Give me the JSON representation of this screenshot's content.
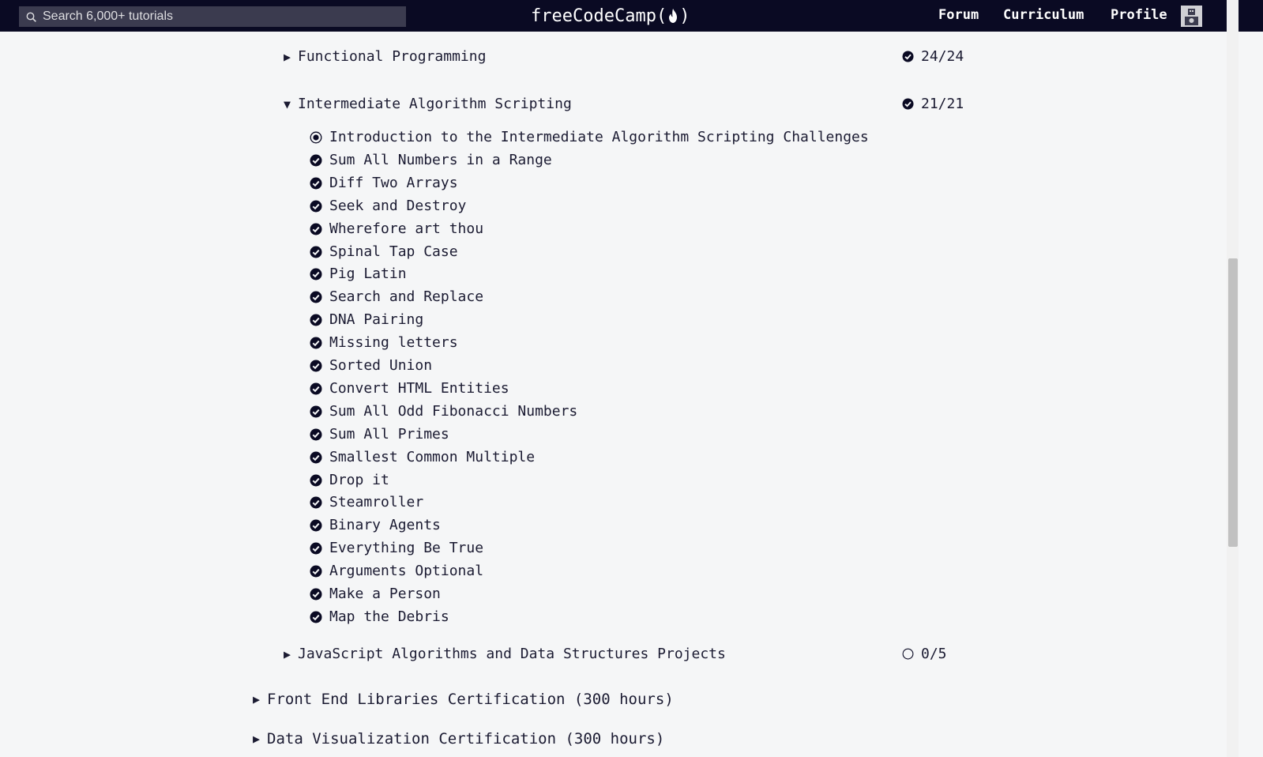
{
  "header": {
    "search_placeholder": "Search 6,000+ tutorials",
    "logo_text_left": "freeCodeCamp(",
    "logo_text_right": ")",
    "nav": [
      "Forum",
      "Curriculum",
      "Profile"
    ]
  },
  "blocks": [
    {
      "title": "Functional Programming",
      "expanded": false,
      "progress": "24/24",
      "complete": true
    },
    {
      "title": "Intermediate Algorithm Scripting",
      "expanded": true,
      "progress": "21/21",
      "complete": true
    },
    {
      "title": "JavaScript Algorithms and Data Structures Projects",
      "expanded": false,
      "progress": "0/5",
      "complete": false
    }
  ],
  "challenges": [
    {
      "title": "Introduction to the Intermediate Algorithm Scripting Challenges",
      "status": "intro"
    },
    {
      "title": "Sum All Numbers in a Range",
      "status": "done"
    },
    {
      "title": "Diff Two Arrays",
      "status": "done"
    },
    {
      "title": "Seek and Destroy",
      "status": "done"
    },
    {
      "title": "Wherefore art thou",
      "status": "done"
    },
    {
      "title": "Spinal Tap Case",
      "status": "done"
    },
    {
      "title": "Pig Latin",
      "status": "done"
    },
    {
      "title": "Search and Replace",
      "status": "done"
    },
    {
      "title": "DNA Pairing",
      "status": "done"
    },
    {
      "title": "Missing letters",
      "status": "done"
    },
    {
      "title": "Sorted Union",
      "status": "done"
    },
    {
      "title": "Convert HTML Entities",
      "status": "done"
    },
    {
      "title": "Sum All Odd Fibonacci Numbers",
      "status": "done"
    },
    {
      "title": "Sum All Primes",
      "status": "done"
    },
    {
      "title": "Smallest Common Multiple",
      "status": "done"
    },
    {
      "title": "Drop it",
      "status": "done"
    },
    {
      "title": "Steamroller",
      "status": "done"
    },
    {
      "title": "Binary Agents",
      "status": "done"
    },
    {
      "title": "Everything Be True",
      "status": "done"
    },
    {
      "title": "Arguments Optional",
      "status": "done"
    },
    {
      "title": "Make a Person",
      "status": "done"
    },
    {
      "title": "Map the Debris",
      "status": "done"
    }
  ],
  "superblocks": [
    {
      "title": "Front End Libraries Certification (300 hours)"
    },
    {
      "title": "Data Visualization Certification (300 hours)"
    }
  ],
  "colors": {
    "nav_bg": "#0a0a23",
    "page_bg": "#f5f6f7",
    "text": "#1b1b32",
    "search_bg": "#3b3b4f"
  }
}
